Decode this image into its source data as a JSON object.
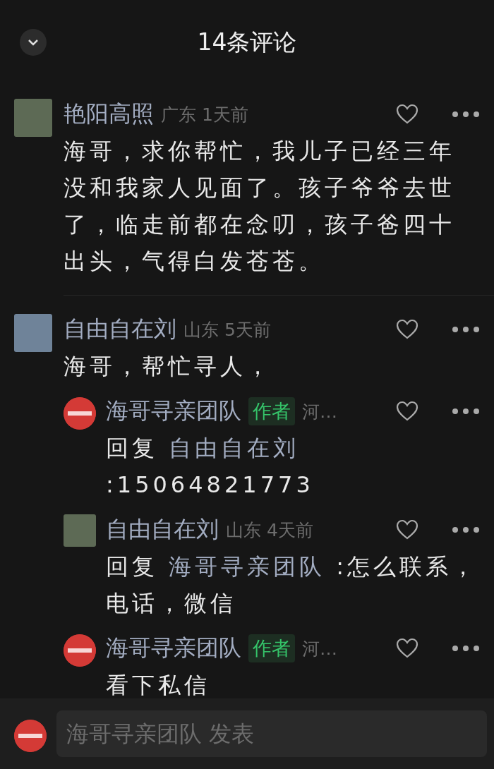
{
  "header": {
    "title": "14条评论"
  },
  "comments": [
    {
      "name": "艳阳高照",
      "meta": "广东 1天前",
      "text": "海哥，求你帮忙，我儿子已经三年没和我家人见面了。孩子爷爷去世了，临走前都在念叨，孩子爸四十出头，气得白发苍苍。",
      "kind": "photo"
    },
    {
      "name": "自由自在刘",
      "meta": "山东 5天前",
      "text": "海哥，帮忙寻人，",
      "kind": "photo",
      "replies": [
        {
          "name": "海哥寻亲团队",
          "badge": "作者",
          "meta": "河…",
          "reply_prefix": "回复",
          "reply_to": "自由自在刘",
          "text": ":15064821773",
          "kind": "logo"
        },
        {
          "name": "自由自在刘",
          "meta": "山东 4天前",
          "reply_prefix": "回复",
          "reply_to": "海哥寻亲团队",
          "text": ":怎么联系，电话，微信",
          "kind": "photo"
        },
        {
          "name": "海哥寻亲团队",
          "badge": "作者",
          "meta": "河…",
          "text": "看下私信",
          "kind": "logo"
        }
      ]
    }
  ],
  "composer": {
    "placeholder": "海哥寻亲团队 发表"
  }
}
